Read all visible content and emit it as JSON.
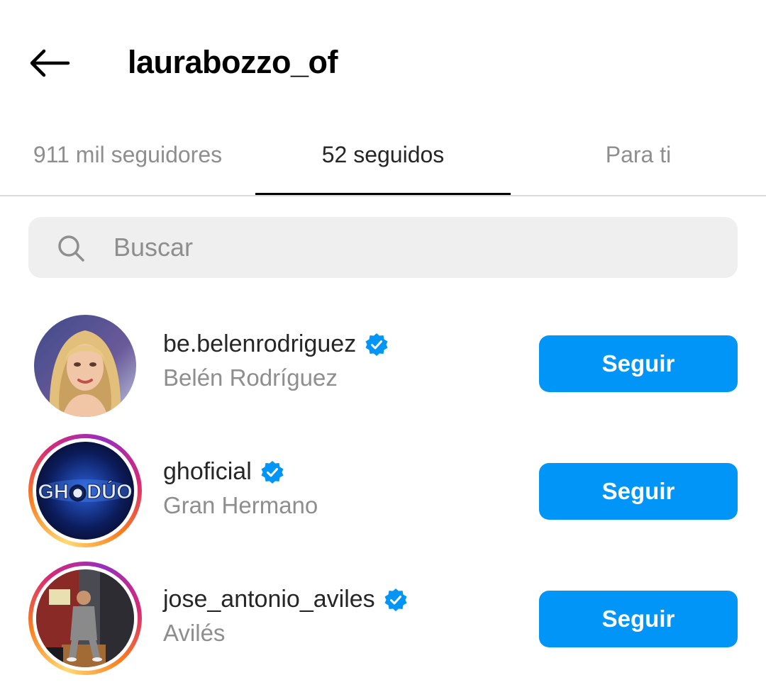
{
  "header": {
    "title": "laurabozzo_of",
    "back_icon": "arrow-left-icon"
  },
  "tabs": [
    {
      "label": "911 mil seguidores",
      "active": false
    },
    {
      "label": "52 seguidos",
      "active": true
    },
    {
      "label": "Para ti",
      "active": false
    }
  ],
  "search": {
    "placeholder": "Buscar",
    "value": "",
    "icon": "search-icon"
  },
  "accounts": [
    {
      "username": "be.belenrodriguez",
      "fullname": "Belén Rodríguez",
      "verified": true,
      "story_ring": false,
      "button": "Seguir"
    },
    {
      "username": "ghoficial",
      "fullname": "Gran Hermano",
      "verified": true,
      "story_ring": true,
      "button": "Seguir",
      "avatar_text": "GH◉DÚO"
    },
    {
      "username": "jose_antonio_aviles",
      "fullname": "Avilés",
      "verified": true,
      "story_ring": true,
      "button": "Seguir"
    }
  ],
  "colors": {
    "primary": "#0095f6",
    "verified": "#0095f6",
    "secondary_text": "#8e8e8e"
  }
}
